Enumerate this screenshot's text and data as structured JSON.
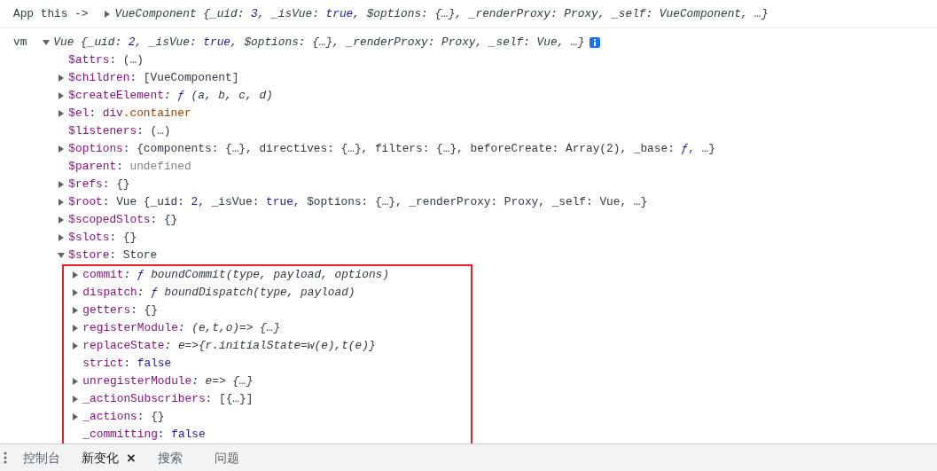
{
  "logs": [
    {
      "label": "App this ->",
      "object": {
        "expandable": true,
        "expanded": false,
        "italic": true,
        "info": false,
        "preview": [
          {
            "text": "VueComponent {_uid: ",
            "kind": "text"
          },
          {
            "text": "3",
            "kind": "num"
          },
          {
            "text": ", _isVue: ",
            "kind": "text"
          },
          {
            "text": "true",
            "kind": "num"
          },
          {
            "text": ", $options: {…}, _renderProxy: Proxy, _self: VueComponent, …}",
            "kind": "text"
          }
        ]
      }
    },
    {
      "label": "vm",
      "object": {
        "expandable": true,
        "expanded": true,
        "italic": true,
        "info": true,
        "preview": [
          {
            "text": "Vue {_uid: ",
            "kind": "text"
          },
          {
            "text": "2",
            "kind": "num"
          },
          {
            "text": ", _isVue: ",
            "kind": "text"
          },
          {
            "text": "true",
            "kind": "num"
          },
          {
            "text": ", $options: {…}, _renderProxy: Proxy, _self: Vue, …}",
            "kind": "text"
          }
        ],
        "properties": [
          {
            "key": "$attrs",
            "expandable": false,
            "italic": false,
            "value": [
              {
                "text": ": ",
                "kind": "text"
              },
              {
                "text": "(…)",
                "kind": "text"
              }
            ]
          },
          {
            "key": "$children",
            "expandable": true,
            "expanded": false,
            "italic": false,
            "value": [
              {
                "text": ": ",
                "kind": "text"
              },
              {
                "text": "[VueComponent]",
                "kind": "text"
              }
            ]
          },
          {
            "key": "$createElement",
            "expandable": true,
            "expanded": false,
            "italic": true,
            "value": [
              {
                "text": ": ",
                "kind": "text"
              },
              {
                "text": "ƒ",
                "kind": "fn"
              },
              {
                "text": " (a, b, c, d)",
                "kind": "text"
              }
            ]
          },
          {
            "key": "$el",
            "expandable": true,
            "expanded": false,
            "italic": false,
            "value": [
              {
                "text": ": ",
                "kind": "text"
              },
              {
                "text": "div",
                "kind": "tag"
              },
              {
                "text": ".container",
                "kind": "cls"
              }
            ]
          },
          {
            "key": "$listeners",
            "expandable": false,
            "italic": false,
            "value": [
              {
                "text": ": ",
                "kind": "text"
              },
              {
                "text": "(…)",
                "kind": "text"
              }
            ]
          },
          {
            "key": "$options",
            "expandable": true,
            "expanded": false,
            "italic": false,
            "value": [
              {
                "text": ": ",
                "kind": "text"
              },
              {
                "text": "{components: {…}, directives: {…}, filters: {…}, beforeCreate: Array(2), _base: ",
                "kind": "text"
              },
              {
                "text": "ƒ",
                "kind": "fn"
              },
              {
                "text": ", …}",
                "kind": "text"
              }
            ]
          },
          {
            "key": "$parent",
            "expandable": false,
            "italic": false,
            "value": [
              {
                "text": ": ",
                "kind": "text"
              },
              {
                "text": "undefined",
                "kind": "dim"
              }
            ]
          },
          {
            "key": "$refs",
            "expandable": true,
            "expanded": false,
            "italic": false,
            "value": [
              {
                "text": ": ",
                "kind": "text"
              },
              {
                "text": "{}",
                "kind": "text"
              }
            ]
          },
          {
            "key": "$root",
            "expandable": true,
            "expanded": false,
            "italic": false,
            "value": [
              {
                "text": ": ",
                "kind": "text"
              },
              {
                "text": "Vue {_uid: ",
                "kind": "text"
              },
              {
                "text": "2",
                "kind": "num"
              },
              {
                "text": ", _isVue: ",
                "kind": "text"
              },
              {
                "text": "true",
                "kind": "num"
              },
              {
                "text": ", $options: {…}, _renderProxy: Proxy, _self: Vue, …}",
                "kind": "text"
              }
            ]
          },
          {
            "key": "$scopedSlots",
            "expandable": true,
            "expanded": false,
            "italic": false,
            "value": [
              {
                "text": ": ",
                "kind": "text"
              },
              {
                "text": "{}",
                "kind": "text"
              }
            ]
          },
          {
            "key": "$slots",
            "expandable": true,
            "expanded": false,
            "italic": false,
            "value": [
              {
                "text": ": ",
                "kind": "text"
              },
              {
                "text": "{}",
                "kind": "text"
              }
            ]
          },
          {
            "key": "$store",
            "expandable": true,
            "expanded": true,
            "italic": false,
            "highlighted": true,
            "value": [
              {
                "text": ": ",
                "kind": "text"
              },
              {
                "text": "Store",
                "kind": "text"
              }
            ],
            "children": [
              {
                "key": "commit",
                "expandable": true,
                "expanded": false,
                "italic": true,
                "value": [
                  {
                    "text": ": ",
                    "kind": "text"
                  },
                  {
                    "text": "ƒ",
                    "kind": "fn"
                  },
                  {
                    "text": " boundCommit(type, payload, options)",
                    "kind": "text"
                  }
                ]
              },
              {
                "key": "dispatch",
                "expandable": true,
                "expanded": false,
                "italic": true,
                "value": [
                  {
                    "text": ": ",
                    "kind": "text"
                  },
                  {
                    "text": "ƒ",
                    "kind": "fn"
                  },
                  {
                    "text": " boundDispatch(type, payload)",
                    "kind": "text"
                  }
                ]
              },
              {
                "key": "getters",
                "expandable": true,
                "expanded": false,
                "italic": false,
                "value": [
                  {
                    "text": ": ",
                    "kind": "text"
                  },
                  {
                    "text": "{}",
                    "kind": "text"
                  }
                ]
              },
              {
                "key": "registerModule",
                "expandable": true,
                "expanded": false,
                "italic": true,
                "value": [
                  {
                    "text": ": ",
                    "kind": "text"
                  },
                  {
                    "text": "(e,t,o)=> {…}",
                    "kind": "text"
                  }
                ]
              },
              {
                "key": "replaceState",
                "expandable": true,
                "expanded": false,
                "italic": true,
                "value": [
                  {
                    "text": ": ",
                    "kind": "text"
                  },
                  {
                    "text": "e=>{r.initialState=w(e),t(e)}",
                    "kind": "text"
                  }
                ]
              },
              {
                "key": "strict",
                "expandable": false,
                "italic": false,
                "value": [
                  {
                    "text": ": ",
                    "kind": "text"
                  },
                  {
                    "text": "false",
                    "kind": "num"
                  }
                ]
              },
              {
                "key": "unregisterModule",
                "expandable": true,
                "expanded": false,
                "italic": true,
                "value": [
                  {
                    "text": ": ",
                    "kind": "text"
                  },
                  {
                    "text": "e=> {…}",
                    "kind": "text"
                  }
                ]
              },
              {
                "key": "_actionSubscribers",
                "expandable": true,
                "expanded": false,
                "italic": false,
                "value": [
                  {
                    "text": ": ",
                    "kind": "text"
                  },
                  {
                    "text": "[{…}]",
                    "kind": "text"
                  }
                ]
              },
              {
                "key": "_actions",
                "expandable": true,
                "expanded": false,
                "italic": false,
                "value": [
                  {
                    "text": ": ",
                    "kind": "text"
                  },
                  {
                    "text": "{}",
                    "kind": "text"
                  }
                ]
              },
              {
                "key": "_committing",
                "expandable": false,
                "italic": false,
                "value": [
                  {
                    "text": ": ",
                    "kind": "text"
                  },
                  {
                    "text": "false",
                    "kind": "num"
                  }
                ]
              }
            ]
          }
        ]
      }
    }
  ],
  "drawer_tabs": [
    {
      "label": "控制台",
      "selected": false,
      "closable": false
    },
    {
      "label": "新变化",
      "selected": true,
      "closable": true,
      "close": "×"
    },
    {
      "label": "搜索",
      "selected": false,
      "closable": false
    },
    {
      "label": "问题",
      "selected": false,
      "closable": false
    }
  ]
}
